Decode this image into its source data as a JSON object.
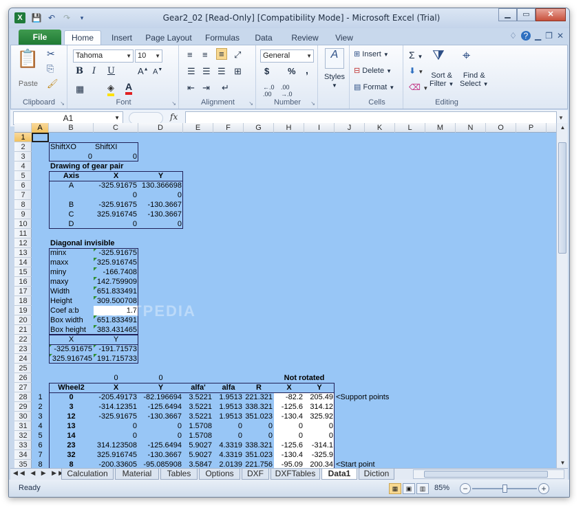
{
  "window": {
    "title": "Gear2_02  [Read-Only]  [Compatibility Mode]  -  Microsoft Excel (Trial)",
    "app_icon": "X"
  },
  "ribbon_tabs": [
    "File",
    "Home",
    "Insert",
    "Page Layout",
    "Formulas",
    "Data",
    "Review",
    "View"
  ],
  "ribbon": {
    "clipboard": {
      "label": "Clipboard",
      "paste": "Paste"
    },
    "font": {
      "label": "Font",
      "name": "Tahoma",
      "size": "10",
      "bold": "B",
      "italic": "I",
      "underline": "U"
    },
    "alignment": {
      "label": "Alignment"
    },
    "number": {
      "label": "Number",
      "format": "General",
      "currency": "$",
      "percent": "%",
      "comma": ","
    },
    "styles": {
      "label": "Styles"
    },
    "cells": {
      "label": "Cells",
      "insert": "Insert",
      "delete": "Delete",
      "format": "Format"
    },
    "editing": {
      "label": "Editing",
      "sort_filter_1": "Sort &",
      "sort_filter_2": "Filter",
      "find_select_1": "Find &",
      "find_select_2": "Select"
    }
  },
  "formula_bar": {
    "name_box": "A1",
    "fx": "fx",
    "value": ""
  },
  "columns": [
    "A",
    "B",
    "C",
    "D",
    "E",
    "F",
    "G",
    "H",
    "I",
    "J",
    "K",
    "L",
    "M",
    "N",
    "O",
    "P"
  ],
  "rows": [
    "1",
    "2",
    "3",
    "4",
    "5",
    "6",
    "7",
    "8",
    "9",
    "10",
    "11",
    "12",
    "13",
    "14",
    "15",
    "16",
    "17",
    "18",
    "19",
    "20",
    "21",
    "22",
    "23",
    "24",
    "25",
    "26",
    "27",
    "28",
    "29",
    "30",
    "31",
    "32",
    "33",
    "34",
    "35"
  ],
  "cells": {
    "r2": {
      "b": "ShiftXO",
      "c": "ShiftXI"
    },
    "r3": {
      "b": "0",
      "c": "0"
    },
    "r4": {
      "b": "Drawing of gear pair"
    },
    "r5": {
      "b": "Axis",
      "c": "X",
      "d": "Y"
    },
    "r6": {
      "b": "A",
      "c": "-325.91675",
      "d": "130.366698"
    },
    "r7": {
      "c": "0",
      "d": "0"
    },
    "r8": {
      "b": "B",
      "c": "-325.91675",
      "d": "-130.3667"
    },
    "r9": {
      "b": "C",
      "c": "325.916745",
      "d": "-130.3667"
    },
    "r10": {
      "b": "D",
      "c": "0",
      "d": "0"
    },
    "r12": {
      "b": "Diagonal invisible"
    },
    "diag": [
      {
        "label": "minx",
        "value": "-325.91675"
      },
      {
        "label": "maxx",
        "value": "325.916745"
      },
      {
        "label": "miny",
        "value": "-166.7408"
      },
      {
        "label": "maxy",
        "value": "142.759909"
      },
      {
        "label": "Width",
        "value": "651.833491"
      },
      {
        "label": "Height",
        "value": "309.500708"
      },
      {
        "label": "Coef a:b",
        "value": "1.7"
      },
      {
        "label": "Box width",
        "value": "651.833491"
      },
      {
        "label": "Box height",
        "value": "383.431465"
      }
    ],
    "r22": {
      "b": "X",
      "c": "Y"
    },
    "r23": {
      "b": "-325.91675",
      "c": "-191.71573"
    },
    "r24": {
      "b": "325.916745",
      "c": "191.715733"
    },
    "r26": {
      "c": "0",
      "d": "0",
      "h": "Not rotated"
    },
    "r27": {
      "b": "Wheel2",
      "c": "X",
      "d": "Y",
      "e": "alfa'",
      "f": "alfa",
      "g": "R",
      "h": "X",
      "i": "Y"
    },
    "wheel": [
      {
        "a": "1",
        "b": "0",
        "c": "-205.49173",
        "d": "-82.196694",
        "e": "3.5221",
        "f": "1.9513",
        "g": "221.321",
        "h": "-82.2",
        "i": "205.49",
        "j": "<Support points"
      },
      {
        "a": "2",
        "b": "3",
        "c": "-314.12351",
        "d": "-125.6494",
        "e": "3.5221",
        "f": "1.9513",
        "g": "338.321",
        "h": "-125.6",
        "i": "314.12",
        "j": ""
      },
      {
        "a": "3",
        "b": "12",
        "c": "-325.91675",
        "d": "-130.3667",
        "e": "3.5221",
        "f": "1.9513",
        "g": "351.023",
        "h": "-130.4",
        "i": "325.92",
        "j": ""
      },
      {
        "a": "4",
        "b": "13",
        "c": "0",
        "d": "0",
        "e": "1.5708",
        "f": "0",
        "g": "0",
        "h": "0",
        "i": "0",
        "j": ""
      },
      {
        "a": "5",
        "b": "14",
        "c": "0",
        "d": "0",
        "e": "1.5708",
        "f": "0",
        "g": "0",
        "h": "0",
        "i": "0",
        "j": ""
      },
      {
        "a": "6",
        "b": "23",
        "c": "314.123508",
        "d": "-125.6494",
        "e": "5.9027",
        "f": "4.3319",
        "g": "338.321",
        "h": "-125.6",
        "i": "-314.1",
        "j": ""
      },
      {
        "a": "7",
        "b": "32",
        "c": "325.916745",
        "d": "-130.3667",
        "e": "5.9027",
        "f": "4.3319",
        "g": "351.023",
        "h": "-130.4",
        "i": "-325.9",
        "j": ""
      },
      {
        "a": "8",
        "b": "8",
        "c": "-200.33605",
        "d": "-95.085908",
        "e": "3.5847",
        "f": "2.0139",
        "g": "221.756",
        "h": "-95.09",
        "i": "200.34",
        "j": "<Start point"
      }
    ]
  },
  "sheet_tabs": [
    "Calculation",
    "Material",
    "Tables",
    "Options",
    "DXF",
    "DXFTables",
    "Data1",
    "Diction"
  ],
  "active_sheet": "Data1",
  "status": {
    "ready": "Ready",
    "zoom": "85%"
  },
  "colors": {
    "sheet_bg": "#98c6f6",
    "selection": "#f1c15f",
    "file_tab": "#1f7a34"
  },
  "watermark": "SOFTPEDIA"
}
